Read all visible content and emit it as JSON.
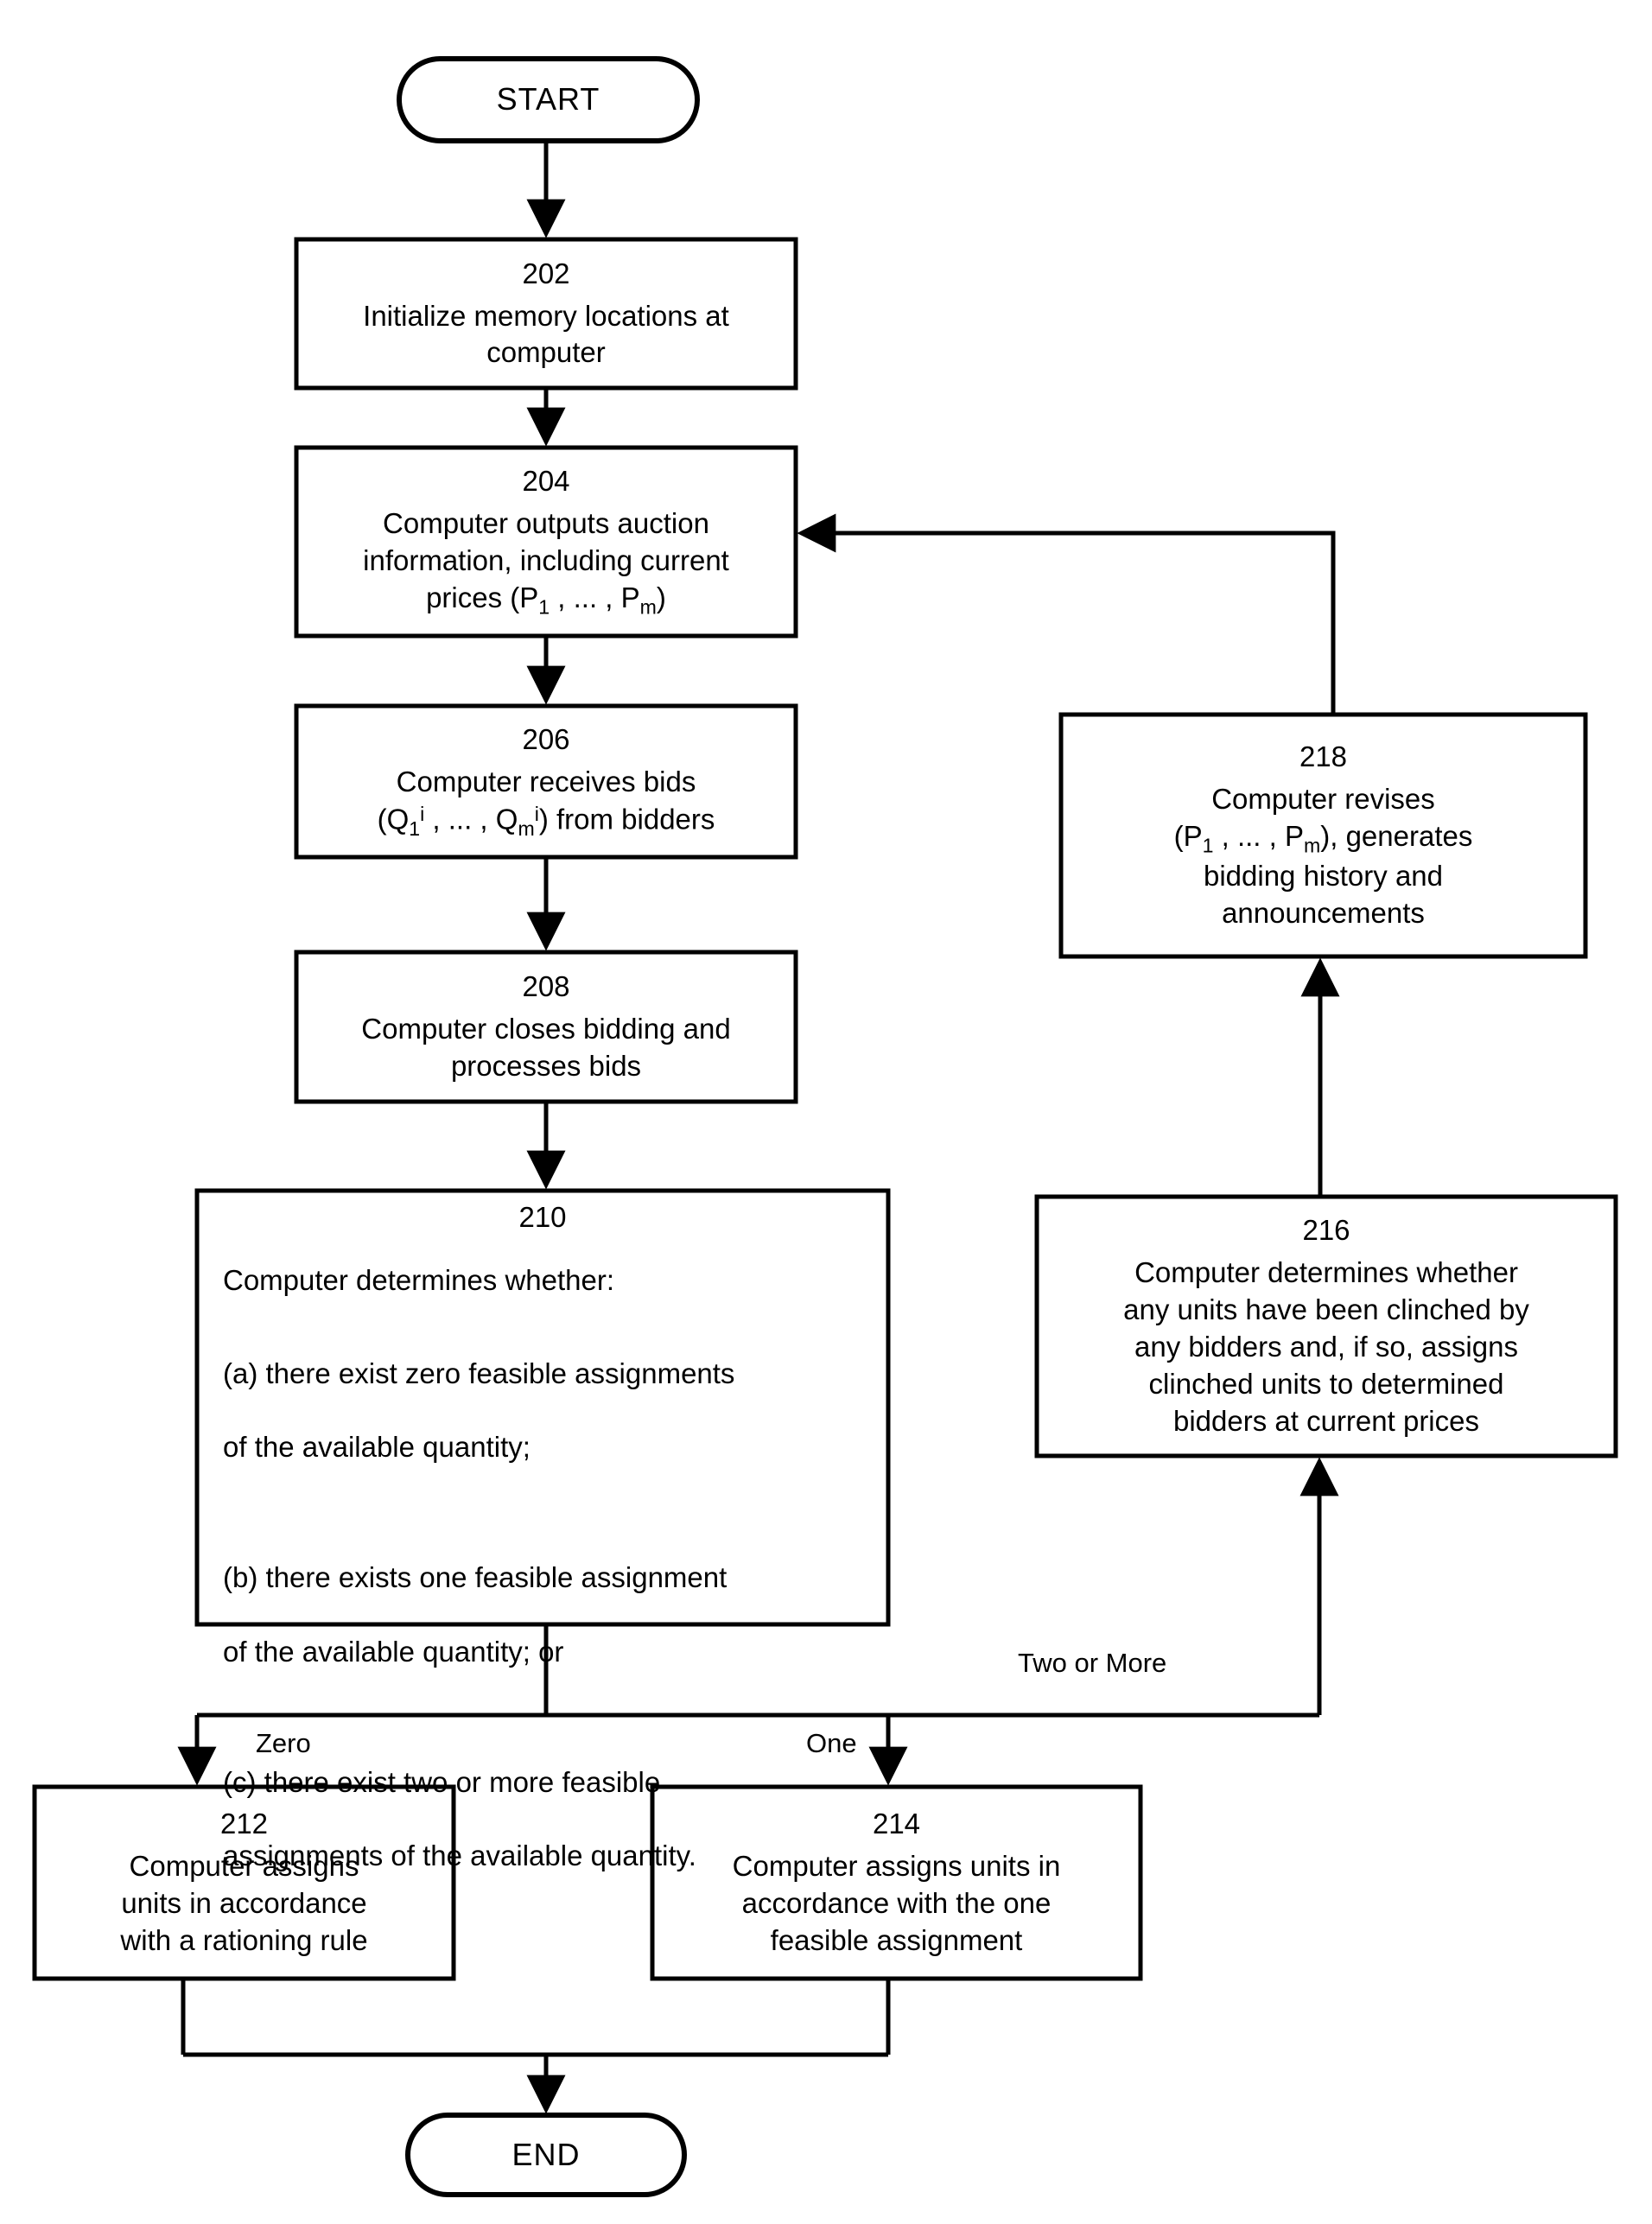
{
  "diagram": {
    "type": "flowchart",
    "title": "",
    "terminals": {
      "start": "START",
      "end": "END"
    },
    "nodes": [
      {
        "id": "202",
        "ref": "202",
        "lines": [
          "Initialize memory locations at",
          "computer"
        ]
      },
      {
        "id": "204",
        "ref": "204",
        "lines": [
          "Computer outputs auction",
          "information, including current",
          "prices (P1 , ... , Pm)"
        ]
      },
      {
        "id": "206",
        "ref": "206",
        "lines": [
          "Computer receives bids",
          "(Q1i , ... , Qmi) from bidders"
        ]
      },
      {
        "id": "208",
        "ref": "208",
        "lines": [
          "Computer closes bidding and",
          "processes bids"
        ]
      },
      {
        "id": "210",
        "ref": "210",
        "lines": [
          "Computer determines whether:",
          "(a) there exist zero feasible assignments of the available quantity;",
          "(b) there exists one feasible assignment of the available quantity; or",
          "(c) there exist two or more feasible assignments of the available quantity."
        ]
      },
      {
        "id": "212",
        "ref": "212",
        "lines": [
          "Computer assigns",
          "units in accordance",
          "with a rationing rule"
        ]
      },
      {
        "id": "214",
        "ref": "214",
        "lines": [
          "Computer assigns units in",
          "accordance with the one",
          "feasible assignment"
        ]
      },
      {
        "id": "216",
        "ref": "216",
        "lines": [
          "Computer determines whether",
          "any units have been clinched by",
          "any bidders and, if so, assigns",
          "clinched units to determined",
          "bidders at current prices"
        ]
      },
      {
        "id": "218",
        "ref": "218",
        "lines": [
          "Computer revises",
          "(P1 , ... , Pm), generates",
          "bidding history and",
          "announcements"
        ]
      }
    ],
    "edge_labels": {
      "zero": "Zero",
      "one": "One",
      "two_or_more": "Two or More"
    },
    "node_210_text": {
      "intro": "Computer determines whether:",
      "a_l1": "(a) there exist zero feasible assignments",
      "a_l2": "of the available quantity;",
      "b_l1": "(b) there exists one feasible assignment",
      "b_l2": "of the available quantity; or",
      "c_l1": "(c) there exist two or more feasible",
      "c_l2": "assignments of the available quantity."
    },
    "node_202_text": {
      "ref": "202",
      "l1": "Initialize memory locations at",
      "l2": "computer"
    },
    "node_204_text": {
      "ref": "204",
      "l1": "Computer outputs auction",
      "l2": "information, including current",
      "l3_pre": "prices (P",
      "l3_sub1": "1",
      "l3_mid": " , ... , P",
      "l3_sub2": "m",
      "l3_post": ")"
    },
    "node_206_text": {
      "ref": "206",
      "l1": "Computer receives bids",
      "l2_pre": "(Q",
      "l2_sub1": "1",
      "l2_sup1": "i",
      "l2_mid": " , ... , Q",
      "l2_sub2": "m",
      "l2_sup2": "i",
      "l2_post": ") from bidders"
    },
    "node_208_text": {
      "ref": "208",
      "l1": "Computer closes bidding and",
      "l2": "processes bids"
    },
    "node_212_text": {
      "ref": "212",
      "l1": "Computer assigns",
      "l2": "units in accordance",
      "l3": "with a rationing rule"
    },
    "node_214_text": {
      "ref": "214",
      "l1": "Computer assigns units in",
      "l2": "accordance with the one",
      "l3": "feasible assignment"
    },
    "node_216_text": {
      "ref": "216",
      "l1": "Computer determines whether",
      "l2": "any units have been clinched by",
      "l3": "any bidders and, if so, assigns",
      "l4": "clinched units to determined",
      "l5": "bidders at current prices"
    },
    "node_218_text": {
      "ref": "218",
      "l1": "Computer revises",
      "l2_pre": "(P",
      "l2_sub1": "1",
      "l2_mid": " , ... , P",
      "l2_sub2": "m",
      "l2_post": "), generates",
      "l3": "bidding history and",
      "l4": "announcements"
    },
    "colors": {
      "stroke": "#000000",
      "fill": "#ffffff",
      "text": "#000000"
    }
  }
}
